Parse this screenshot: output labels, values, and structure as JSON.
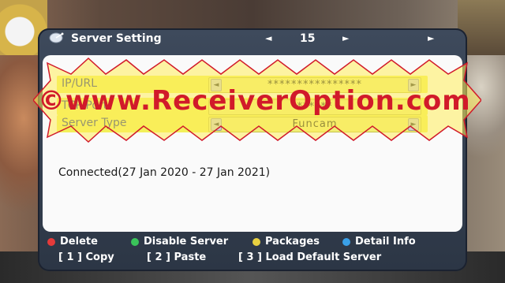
{
  "title": "Server Setting",
  "page": {
    "prev_glyph": "◄",
    "number": "15",
    "next_glyph": "►",
    "end_glyph": "►"
  },
  "fields": [
    {
      "label": "IP/URL",
      "value": "****************"
    },
    {
      "label": "TCP Port",
      "value": "******"
    },
    {
      "label": "Server Type",
      "value": "Funcam"
    }
  ],
  "status": "Connected(27 Jan 2020 - 27 Jan 2021)",
  "legend": [
    {
      "label": "Delete",
      "color": "#e53a3a"
    },
    {
      "label": "Disable Server",
      "color": "#3ac45a"
    },
    {
      "label": "Packages",
      "color": "#e8d040"
    },
    {
      "label": "Detail Info",
      "color": "#3aa0e8"
    }
  ],
  "shortcuts": [
    {
      "label": "[ 1 ] Copy"
    },
    {
      "label": "[ 2 ] Paste"
    },
    {
      "label": "[ 3 ] Load Default Server"
    }
  ],
  "watermark": "©www.ReceiverOption.com",
  "colors": {
    "highlight": "#f2f05a",
    "dialog": "#3e4a5c",
    "panel": "#fafafa",
    "watermark": "#d11a2a"
  }
}
